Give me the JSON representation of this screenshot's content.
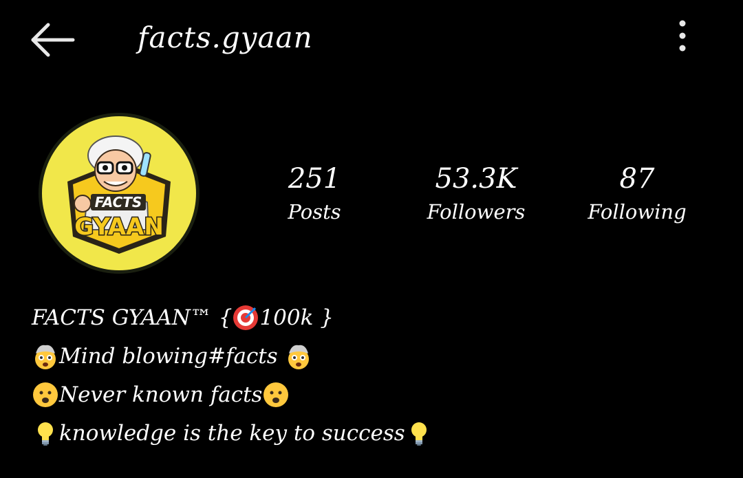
{
  "header": {
    "username": "facts.gyaan",
    "back_icon": "arrow-left-icon",
    "menu_icon": "more-vertical-icon"
  },
  "avatar": {
    "logo_line1": "FACTS",
    "logo_line2": "GYAAN",
    "background_color": "#f1e74a",
    "accent_color": "#f6c91e"
  },
  "stats": [
    {
      "value": "251",
      "label": "Posts"
    },
    {
      "value": "53.3K",
      "label": "Followers"
    },
    {
      "value": "87",
      "label": "Following"
    }
  ],
  "bio": {
    "name": "FACTS GYAAN™ { ",
    "goal": "100k }",
    "line2_text": "Mind blowing ",
    "line2_hashtag": "#facts",
    "line3_text": "Never known facts",
    "line4_text": " knowledge is the key to success",
    "icons": [
      "target-icon",
      "exploding-head-icon",
      "frowning-face-icon",
      "light-bulb-icon"
    ]
  }
}
